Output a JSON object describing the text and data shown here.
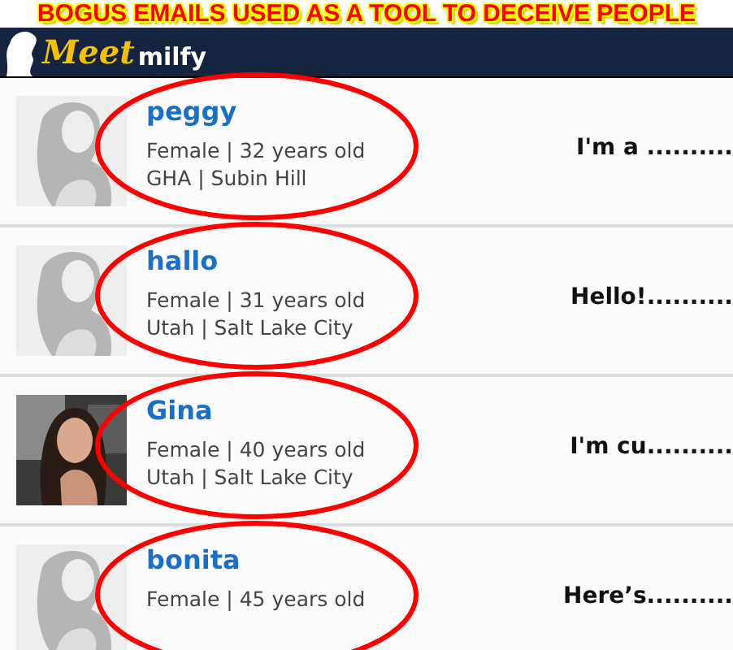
{
  "banner": {
    "text": "BOGUS EMAILS USED AS A TOOL TO DECEIVE PEOPLE"
  },
  "header": {
    "logo_script": "Meet",
    "logo_text": "milfy"
  },
  "profiles": [
    {
      "name": "peggy",
      "details": "Female | 32 years old",
      "location": "GHA | Subin Hill",
      "teaser": "I'm a ..........",
      "photo": {
        "kind": "placeholder"
      }
    },
    {
      "name": "hallo",
      "details": "Female | 31 years old",
      "location": "Utah | Salt Lake City",
      "teaser": "Hello!..........",
      "photo": {
        "kind": "placeholder"
      }
    },
    {
      "name": "Gina",
      "details": "Female | 40 years old",
      "location": "Utah | Salt Lake City",
      "teaser": "I'm cu.........."
    },
    {
      "name": "bonita",
      "details": "Female | 45 years old",
      "teaser": "Here’s..........",
      "photo": {
        "kind": "placeholder"
      }
    }
  ]
}
